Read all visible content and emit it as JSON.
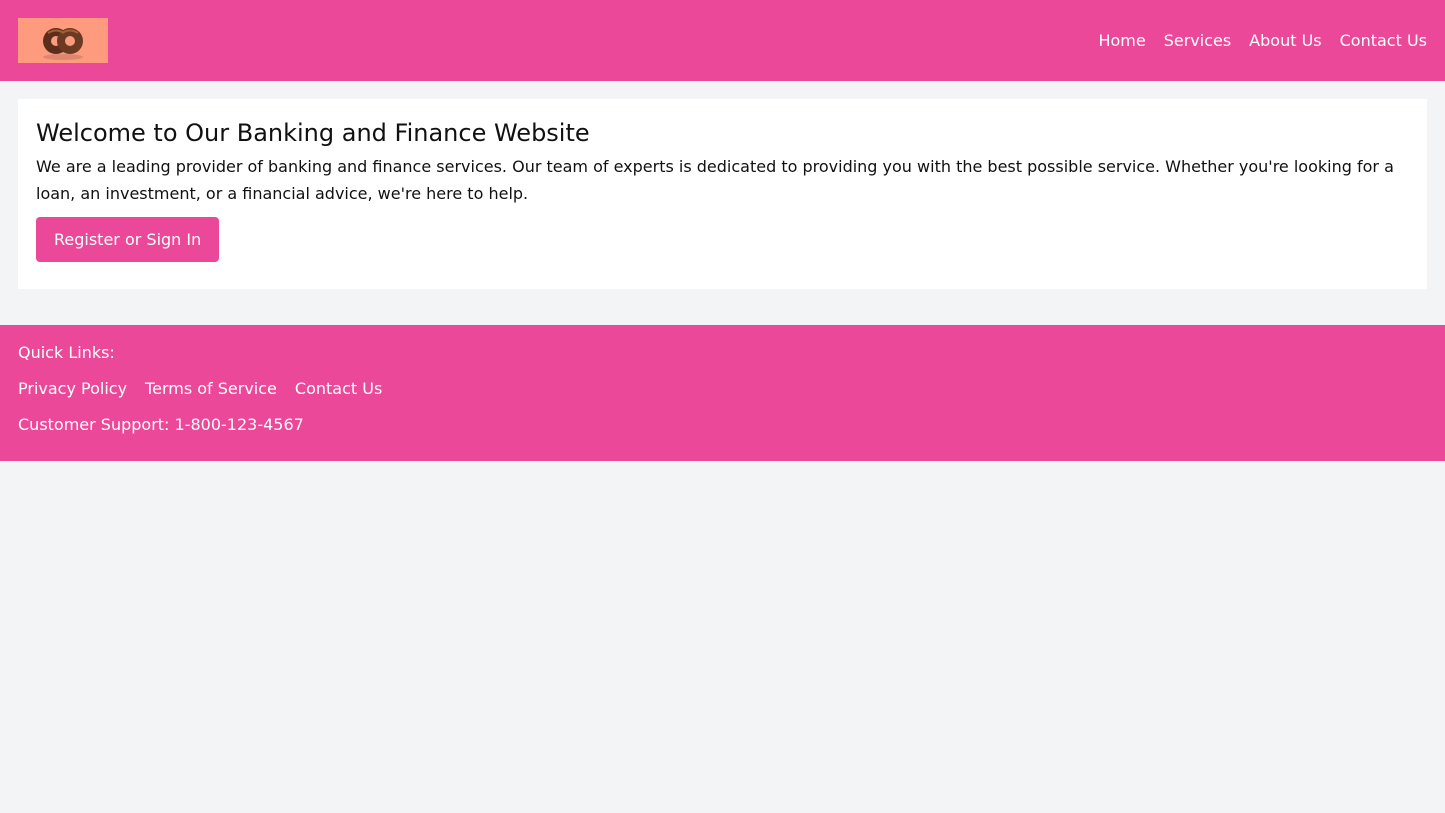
{
  "header": {
    "logo_icon": "donut-logo-icon",
    "nav": {
      "home": "Home",
      "services": "Services",
      "about": "About Us",
      "contact": "Contact Us"
    }
  },
  "main": {
    "title": "Welcome to Our Banking and Finance Website",
    "description": "We are a leading provider of banking and finance services. Our team of experts is dedicated to providing you with the best possible service. Whether you're looking for a loan, an investment, or a financial advice, we're here to help.",
    "cta_label": "Register or Sign In"
  },
  "footer": {
    "quick_links_label": "Quick Links:",
    "links": {
      "privacy": "Privacy Policy",
      "terms": "Terms of Service",
      "contact": "Contact Us"
    },
    "support": "Customer Support: 1-800-123-4567"
  },
  "colors": {
    "accent": "#ec4899",
    "background": "#f3f4f6",
    "card": "#ffffff",
    "logo_bg": "#fe9a7e"
  }
}
